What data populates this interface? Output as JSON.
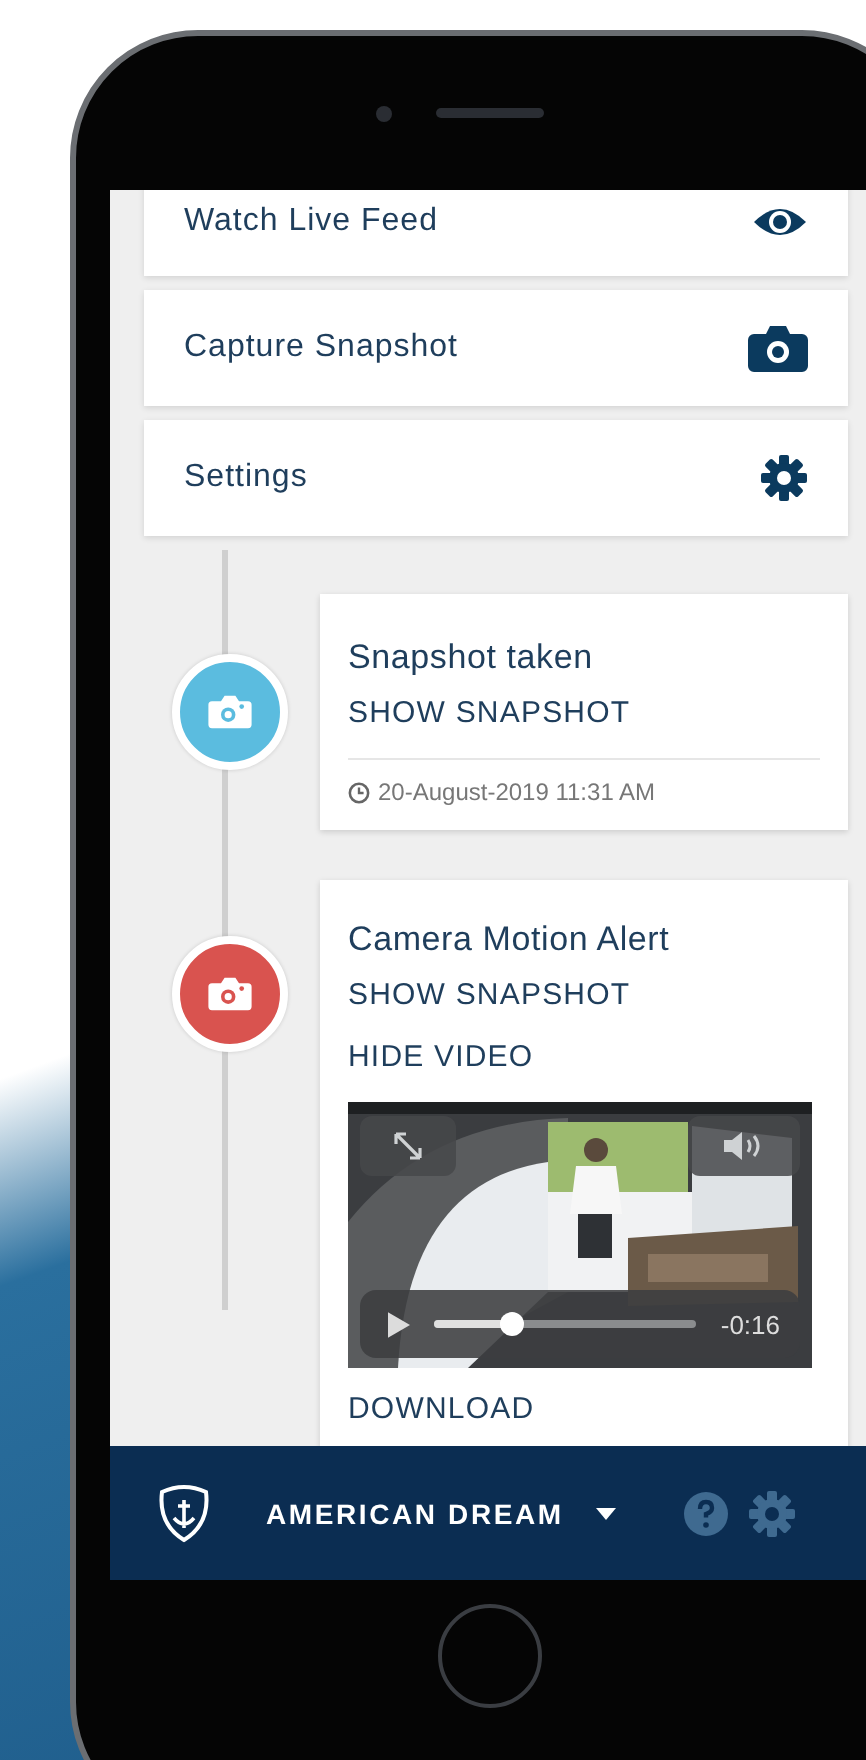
{
  "menu": [
    {
      "label": "Watch Live Feed",
      "kind": "eye"
    },
    {
      "label": "Capture Snapshot",
      "kind": "camera"
    },
    {
      "label": "Settings",
      "kind": "gear"
    }
  ],
  "timeline": [
    {
      "kind": "snapshot",
      "color": "#5bbcdf",
      "title": "Snapshot taken",
      "actions": [
        "SHOW SNAPSHOT"
      ],
      "timestamp": "20-August-2019 11:31 AM"
    },
    {
      "kind": "motion",
      "color": "#d9534f",
      "title": "Camera Motion Alert",
      "actions": [
        "SHOW SNAPSHOT",
        "HIDE VIDEO"
      ],
      "video": {
        "time": "-0:16",
        "level": 0.3
      },
      "footer_link": "DOWNLOAD"
    }
  ],
  "bottom_bar": {
    "vessel": "AMERICAN DREAM"
  }
}
